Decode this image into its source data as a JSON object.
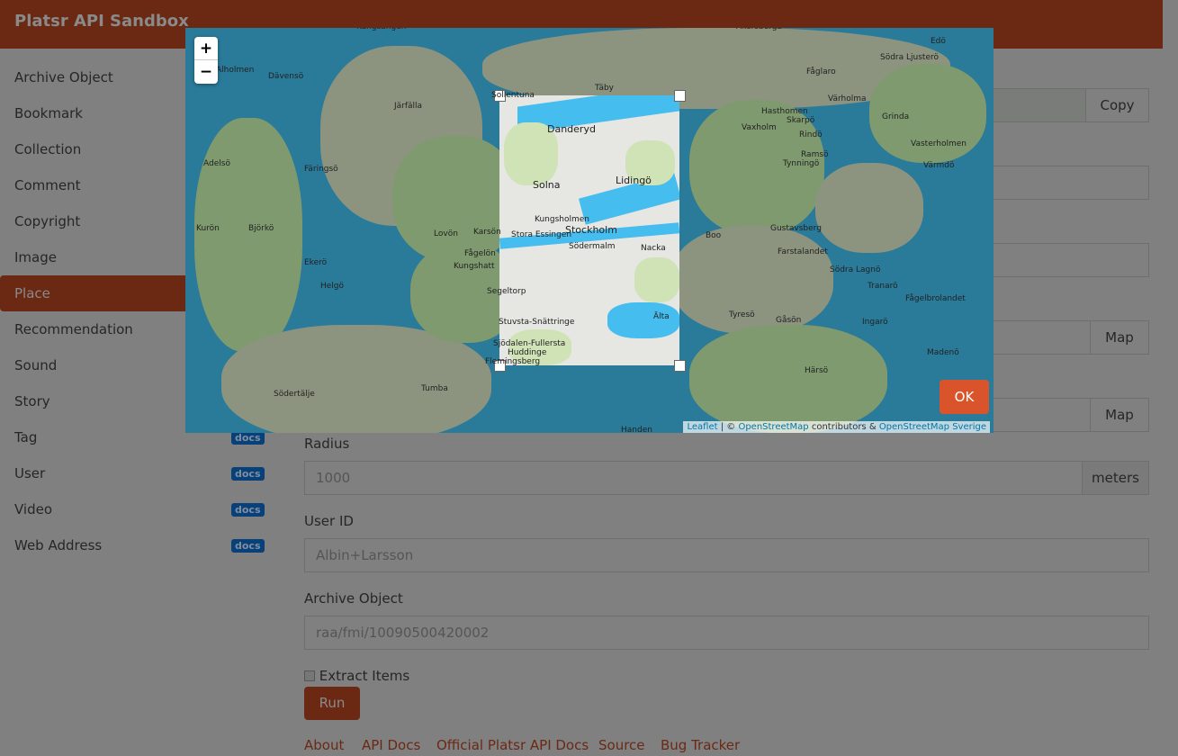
{
  "header": {
    "title": "Platsr API Sandbox"
  },
  "sidebar": {
    "items": [
      {
        "label": "Archive Object"
      },
      {
        "label": "Bookmark"
      },
      {
        "label": "Collection"
      },
      {
        "label": "Comment"
      },
      {
        "label": "Copyright"
      },
      {
        "label": "Image"
      },
      {
        "label": "Place",
        "active": true
      },
      {
        "label": "Recommendation"
      },
      {
        "label": "Sound"
      },
      {
        "label": "Story"
      },
      {
        "label": "Tag",
        "docs": "docs"
      },
      {
        "label": "User",
        "docs": "docs"
      },
      {
        "label": "Video",
        "docs": "docs"
      },
      {
        "label": "Web Address",
        "docs": "docs"
      }
    ]
  },
  "form": {
    "copy_label": "Copy",
    "map_label_1": "Map",
    "map_label_2": "Map",
    "radius_label": "Radius",
    "radius_value": "1000",
    "radius_unit": "meters",
    "user_id_label": "User ID",
    "user_id_value": "Albin+Larsson",
    "archive_object_label": "Archive Object",
    "archive_object_value": "raa/fmi/10090500420002",
    "extract_items_label": "Extract Items",
    "extract_items_checked": false,
    "run_label": "Run"
  },
  "footer": {
    "links": [
      "About",
      "API Docs",
      "Official Platsr API Docs",
      "Source",
      "Bug Tracker"
    ]
  },
  "map_modal": {
    "zoom_in": "+",
    "zoom_out": "−",
    "ok_label": "OK",
    "attribution": {
      "leaflet": "Leaflet",
      "sep": " | © ",
      "osm": "OpenStreetMap",
      "contrib": " contributors & ",
      "osm_se": "OpenStreetMap Sverige"
    },
    "places": [
      "Kungsängen",
      "Åkersberga",
      "Alholmen",
      "Dävensö",
      "Järfälla",
      "Sollentuna",
      "Täby",
      "Danderyd",
      "Solna",
      "Lidingö",
      "Kungsholmen",
      "Stockholm",
      "Stora Essingen",
      "Södermalm",
      "Nacka",
      "Adelsö",
      "Färingsö",
      "Kurön",
      "Björkö",
      "Lovön",
      "Ekerö",
      "Helgö",
      "Fågelön",
      "Kungshatt",
      "Segeltorp",
      "Stuvsta-Snättringe",
      "Sjödalen-Fullersta",
      "Huddinge",
      "Flemingsberg",
      "Älta",
      "Boo",
      "Gustavsberg",
      "Farstalandet",
      "Vaxholm",
      "Värmdö",
      "Tyresö",
      "Södertälje",
      "Tumba",
      "Handen",
      "Ingarö",
      "Gåsön",
      "Härsö",
      "Tranarö",
      "Södra Lagnö",
      "Fågelbrolandet",
      "Madenö",
      "Hasthomen",
      "Skarpö",
      "Rindö",
      "Ramsö",
      "Tynningö",
      "Fåglaro",
      "Södra Ljusterö",
      "Grinda",
      "Vasterholmen",
      "Värholma",
      "Edö",
      "Karsön"
    ],
    "colors": {
      "accent": "#d9532b",
      "selection_water": "#45bdee"
    }
  }
}
